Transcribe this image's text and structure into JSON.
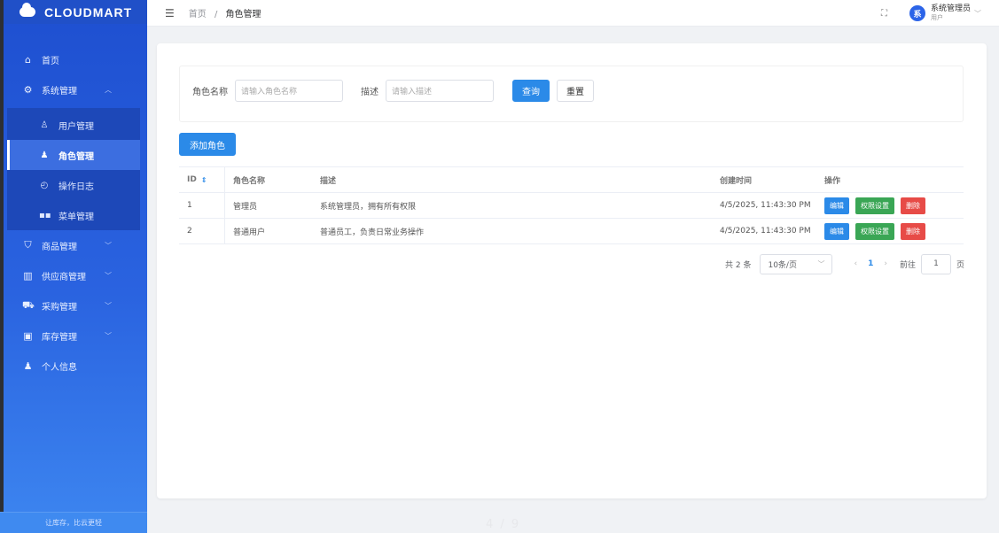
{
  "app": {
    "name": "CLOUDMART",
    "footer": "让库存，比云更轻"
  },
  "sidebar": {
    "home": "首页",
    "system": "系统管理",
    "system_sub": [
      "用户管理",
      "角色管理",
      "操作日志",
      "菜单管理"
    ],
    "goods": "商品管理",
    "supplier": "供应商管理",
    "purchase": "采购管理",
    "inventory": "库存管理",
    "profile": "个人信息"
  },
  "header": {
    "breadcrumb_home": "首页",
    "breadcrumb_sep": "/",
    "breadcrumb_current": "角色管理",
    "user_name": "系统管理员",
    "user_role": "用户",
    "avatar_text": "系"
  },
  "search": {
    "role_name_label": "角色名称",
    "role_name_placeholder": "请输入角色名称",
    "desc_label": "描述",
    "desc_placeholder": "请输入描述",
    "query_btn": "查询",
    "reset_btn": "重置"
  },
  "add_btn": "添加角色",
  "table": {
    "headers": [
      "ID",
      "角色名称",
      "描述",
      "创建时间",
      "操作"
    ],
    "rows": [
      {
        "id": "1",
        "name": "管理员",
        "desc": "系统管理员，拥有所有权限",
        "created": "4/5/2025, 11:43:30 PM",
        "edit": "编辑",
        "perm": "权限设置",
        "del": "删除"
      },
      {
        "id": "2",
        "name": "普通用户",
        "desc": "普通员工，负责日常业务操作",
        "created": "4/5/2025, 11:43:30 PM",
        "edit": "编辑",
        "perm": "权限设置",
        "del": "删除"
      }
    ]
  },
  "pagination": {
    "total": "共 2 条",
    "page_size": "10条/页",
    "current": "1",
    "goto_label": "前往",
    "goto_value": "1",
    "page_unit": "页"
  },
  "overlay": {
    "page_indicator": "4 / 9"
  }
}
